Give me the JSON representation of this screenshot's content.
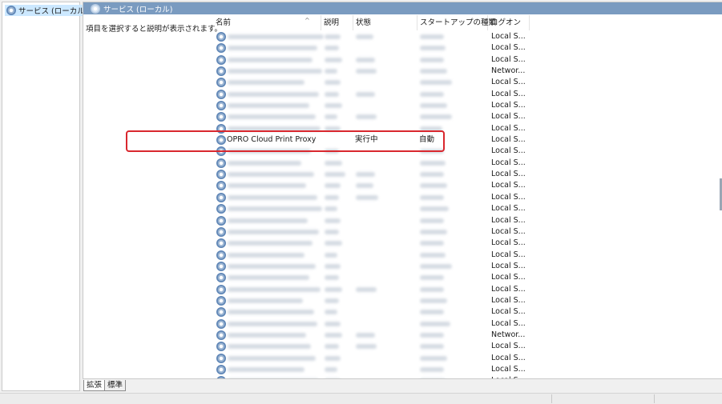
{
  "tree": {
    "item_label": "サービス (ローカル)"
  },
  "pane": {
    "title": "サービス (ローカル)",
    "description_prompt": "項目を選択すると説明が表示されます。"
  },
  "columns": {
    "name": "名前",
    "description": "説明",
    "status": "状態",
    "startup": "スタートアップの種類",
    "logon": "ログオン"
  },
  "rows": [
    {
      "logon": "Local S..."
    },
    {
      "logon": "Local S..."
    },
    {
      "logon": "Local S..."
    },
    {
      "logon": "Networ..."
    },
    {
      "logon": "Local S..."
    },
    {
      "logon": "Local S..."
    },
    {
      "logon": "Local S..."
    },
    {
      "logon": "Local S..."
    },
    {
      "logon": "Local S..."
    },
    {
      "name": "OPRO Cloud Print Proxy",
      "status": "実行中",
      "startup": "自動",
      "logon": "Local S...",
      "highlighted": true
    },
    {
      "logon": "Local S..."
    },
    {
      "logon": "Local S..."
    },
    {
      "logon": "Local S..."
    },
    {
      "logon": "Local S..."
    },
    {
      "logon": "Local S..."
    },
    {
      "logon": "Local S..."
    },
    {
      "logon": "Local S..."
    },
    {
      "logon": "Local S..."
    },
    {
      "logon": "Local S..."
    },
    {
      "logon": "Local S..."
    },
    {
      "logon": "Local S..."
    },
    {
      "logon": "Local S..."
    },
    {
      "logon": "Local S..."
    },
    {
      "logon": "Local S..."
    },
    {
      "logon": "Local S..."
    },
    {
      "logon": "Local S..."
    },
    {
      "logon": "Networ..."
    },
    {
      "logon": "Local S..."
    },
    {
      "logon": "Local S..."
    },
    {
      "logon": "Local S..."
    },
    {
      "logon": "Local S..."
    }
  ],
  "tabs": {
    "extended": "拡張",
    "standard": "標準"
  },
  "colors": {
    "title_bar": "#7a9bc0",
    "selection": "#cce8ff",
    "highlight_box": "#d9272e"
  },
  "icons": {
    "service": "gear-icon",
    "sort": "sort-up-icon"
  }
}
